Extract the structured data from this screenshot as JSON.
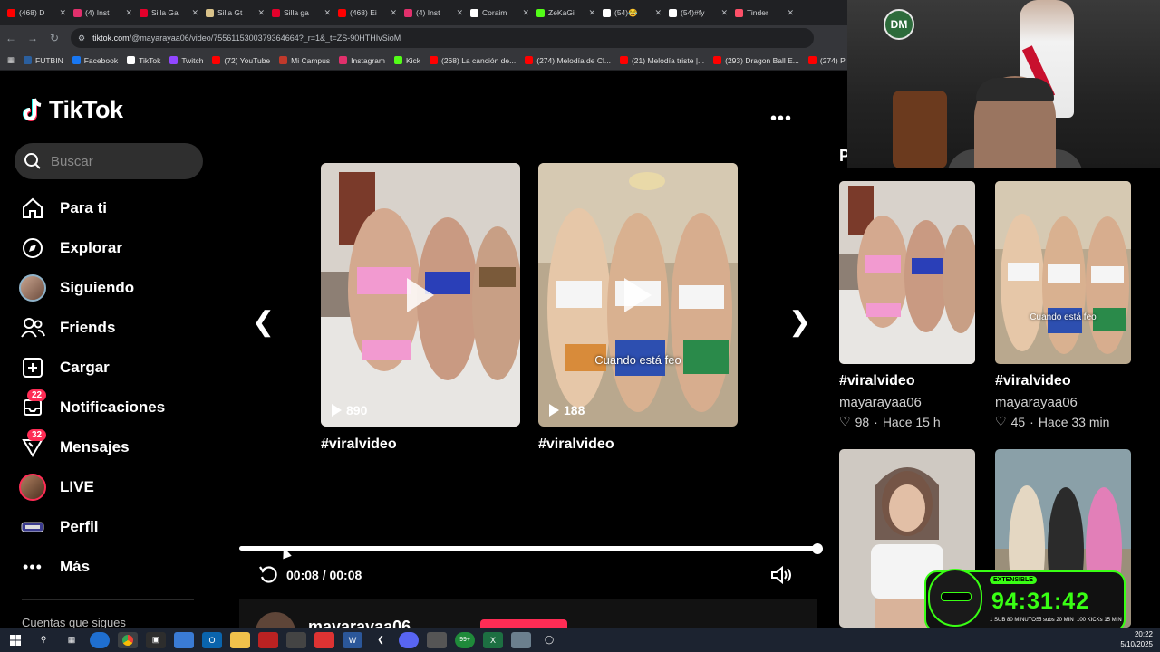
{
  "browser": {
    "tabs": [
      {
        "title": "(468) D",
        "color": "#ff0000"
      },
      {
        "title": "(4) Inst",
        "color": "#e1306c"
      },
      {
        "title": "Silla Ga",
        "color": "#e4002b"
      },
      {
        "title": "Silla Gt",
        "color": "#d9c28a"
      },
      {
        "title": "Silla ga",
        "color": "#e4002b"
      },
      {
        "title": "(468) Ei",
        "color": "#ff0000"
      },
      {
        "title": "(4) Inst",
        "color": "#e1306c"
      },
      {
        "title": "Coraim",
        "color": "#ffffff"
      },
      {
        "title": "ZeKaGi",
        "color": "#53fc18"
      },
      {
        "title": "(54)😂",
        "color": "#ffffff"
      },
      {
        "title": "(54)#fy",
        "color": "#ffffff"
      },
      {
        "title": "Tinder",
        "color": "#fd5068"
      }
    ],
    "url_host": "tiktok.com",
    "url_path": "/@mayarayaa06/video/7556115300379364664?_r=1&_t=ZS-90HTHIvSioM",
    "bookmarks": [
      {
        "label": "FUTBIN",
        "color": "#2b5f9e"
      },
      {
        "label": "Facebook",
        "color": "#1877f2"
      },
      {
        "label": "TikTok",
        "color": "#ffffff"
      },
      {
        "label": "Twitch",
        "color": "#9146ff"
      },
      {
        "label": "(72) YouTube",
        "color": "#ff0000"
      },
      {
        "label": "Mi Campus",
        "color": "#c0392b"
      },
      {
        "label": "Instagram",
        "color": "#e1306c"
      },
      {
        "label": "Kick",
        "color": "#53fc18"
      },
      {
        "label": "(268) La canción de...",
        "color": "#ff0000"
      },
      {
        "label": "(274) Melodía de Cl...",
        "color": "#ff0000"
      },
      {
        "label": "(21) Melodía triste |...",
        "color": "#ff0000"
      },
      {
        "label": "(293) Dragon Ball E...",
        "color": "#ff0000"
      },
      {
        "label": "(274) P",
        "color": "#ff0000"
      }
    ]
  },
  "sidebar": {
    "logo_text": "TikTok",
    "search_placeholder": "Buscar",
    "items": [
      {
        "label": "Para ti",
        "icon": "home-icon"
      },
      {
        "label": "Explorar",
        "icon": "compass-icon"
      },
      {
        "label": "Siguiendo",
        "icon": "avatar"
      },
      {
        "label": "Friends",
        "icon": "friends-icon"
      },
      {
        "label": "Cargar",
        "icon": "upload-icon"
      },
      {
        "label": "Notificaciones",
        "icon": "inbox-icon",
        "badge": "22"
      },
      {
        "label": "Mensajes",
        "icon": "message-icon",
        "badge": "32"
      },
      {
        "label": "LIVE",
        "icon": "live-avatar"
      },
      {
        "label": "Perfil",
        "icon": "profile-icon"
      },
      {
        "label": "Más",
        "icon": "more-icon"
      }
    ],
    "following_heading": "Cuentas que sigues"
  },
  "main": {
    "cards": [
      {
        "views": "890",
        "caption": "#viralvideo",
        "overlay": ""
      },
      {
        "views": "188",
        "caption": "#viralvideo",
        "overlay": "Cuando está feo"
      }
    ],
    "time": "00:08 / 00:08",
    "progress_fraction": 1.0,
    "author": "mayarayaa06"
  },
  "right": {
    "heading_initial": "P",
    "videos": [
      {
        "caption": "#viralvideo",
        "author": "mayarayaa06",
        "likes": "98",
        "age": "Hace 15 h",
        "overlay": ""
      },
      {
        "caption": "#viralvideo",
        "author": "mayarayaa06",
        "likes": "45",
        "age": "Hace 33 min",
        "overlay": "Cuando está feo"
      }
    ]
  },
  "timer": {
    "badge": "EXTENSIBLE",
    "value": "94:31:42",
    "sub1": "1 SUB 80 MINUTOS",
    "sub2": "5 subs 20 MIN",
    "sub3": "100 KICKs 15 MIN"
  },
  "webcam": {
    "logo": "DM"
  },
  "taskbar": {
    "badge": "99+",
    "time": "20:22",
    "date": "5/10/2025"
  }
}
